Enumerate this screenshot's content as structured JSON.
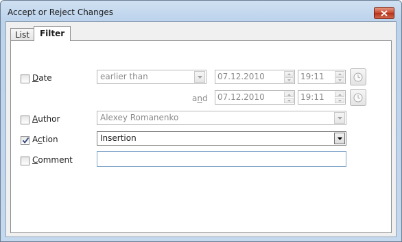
{
  "window": {
    "title": "Accept or Reject Changes"
  },
  "tabs": [
    {
      "label": "List",
      "active": false
    },
    {
      "label": "Filter",
      "active": true
    }
  ],
  "filter": {
    "date": {
      "label_hot": "D",
      "label_rest": "ate",
      "checked": false,
      "condition": "earlier than",
      "start_date": "07.12.2010",
      "start_time": "19:11",
      "and_label_pre": "a",
      "and_label_hot": "n",
      "and_label_post": "d",
      "end_date": "07.12.2010",
      "end_time": "19:11"
    },
    "author": {
      "label_hot": "A",
      "label_rest": "uthor",
      "checked": false,
      "value": "Alexey Romanenko"
    },
    "action": {
      "label_pre": "A",
      "label_hot": "c",
      "label_rest": "tion",
      "checked": true,
      "value": "Insertion"
    },
    "comment": {
      "label_hot": "C",
      "label_rest": "omment",
      "checked": false,
      "value": ""
    }
  },
  "icons": {
    "close": "close-icon",
    "clock": "clock-icon",
    "dropdown": "chevron-down-icon",
    "check": "checkmark-icon"
  }
}
